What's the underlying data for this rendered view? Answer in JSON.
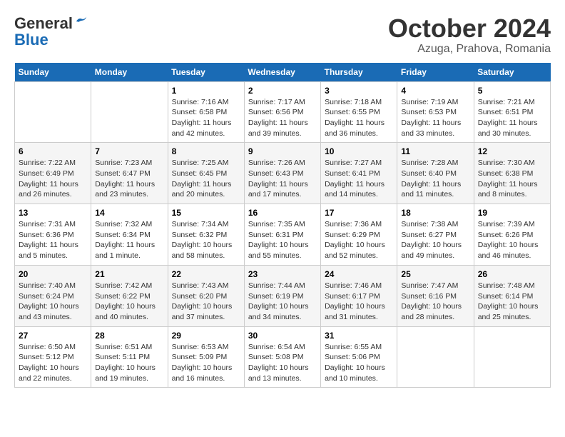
{
  "header": {
    "logo_line1": "General",
    "logo_line2": "Blue",
    "title": "October 2024",
    "subtitle": "Azuga, Prahova, Romania"
  },
  "days_of_week": [
    "Sunday",
    "Monday",
    "Tuesday",
    "Wednesday",
    "Thursday",
    "Friday",
    "Saturday"
  ],
  "weeks": [
    [
      {
        "day": "",
        "info": ""
      },
      {
        "day": "",
        "info": ""
      },
      {
        "day": "1",
        "info": "Sunrise: 7:16 AM\nSunset: 6:58 PM\nDaylight: 11 hours and 42 minutes."
      },
      {
        "day": "2",
        "info": "Sunrise: 7:17 AM\nSunset: 6:56 PM\nDaylight: 11 hours and 39 minutes."
      },
      {
        "day": "3",
        "info": "Sunrise: 7:18 AM\nSunset: 6:55 PM\nDaylight: 11 hours and 36 minutes."
      },
      {
        "day": "4",
        "info": "Sunrise: 7:19 AM\nSunset: 6:53 PM\nDaylight: 11 hours and 33 minutes."
      },
      {
        "day": "5",
        "info": "Sunrise: 7:21 AM\nSunset: 6:51 PM\nDaylight: 11 hours and 30 minutes."
      }
    ],
    [
      {
        "day": "6",
        "info": "Sunrise: 7:22 AM\nSunset: 6:49 PM\nDaylight: 11 hours and 26 minutes."
      },
      {
        "day": "7",
        "info": "Sunrise: 7:23 AM\nSunset: 6:47 PM\nDaylight: 11 hours and 23 minutes."
      },
      {
        "day": "8",
        "info": "Sunrise: 7:25 AM\nSunset: 6:45 PM\nDaylight: 11 hours and 20 minutes."
      },
      {
        "day": "9",
        "info": "Sunrise: 7:26 AM\nSunset: 6:43 PM\nDaylight: 11 hours and 17 minutes."
      },
      {
        "day": "10",
        "info": "Sunrise: 7:27 AM\nSunset: 6:41 PM\nDaylight: 11 hours and 14 minutes."
      },
      {
        "day": "11",
        "info": "Sunrise: 7:28 AM\nSunset: 6:40 PM\nDaylight: 11 hours and 11 minutes."
      },
      {
        "day": "12",
        "info": "Sunrise: 7:30 AM\nSunset: 6:38 PM\nDaylight: 11 hours and 8 minutes."
      }
    ],
    [
      {
        "day": "13",
        "info": "Sunrise: 7:31 AM\nSunset: 6:36 PM\nDaylight: 11 hours and 5 minutes."
      },
      {
        "day": "14",
        "info": "Sunrise: 7:32 AM\nSunset: 6:34 PM\nDaylight: 11 hours and 1 minute."
      },
      {
        "day": "15",
        "info": "Sunrise: 7:34 AM\nSunset: 6:32 PM\nDaylight: 10 hours and 58 minutes."
      },
      {
        "day": "16",
        "info": "Sunrise: 7:35 AM\nSunset: 6:31 PM\nDaylight: 10 hours and 55 minutes."
      },
      {
        "day": "17",
        "info": "Sunrise: 7:36 AM\nSunset: 6:29 PM\nDaylight: 10 hours and 52 minutes."
      },
      {
        "day": "18",
        "info": "Sunrise: 7:38 AM\nSunset: 6:27 PM\nDaylight: 10 hours and 49 minutes."
      },
      {
        "day": "19",
        "info": "Sunrise: 7:39 AM\nSunset: 6:26 PM\nDaylight: 10 hours and 46 minutes."
      }
    ],
    [
      {
        "day": "20",
        "info": "Sunrise: 7:40 AM\nSunset: 6:24 PM\nDaylight: 10 hours and 43 minutes."
      },
      {
        "day": "21",
        "info": "Sunrise: 7:42 AM\nSunset: 6:22 PM\nDaylight: 10 hours and 40 minutes."
      },
      {
        "day": "22",
        "info": "Sunrise: 7:43 AM\nSunset: 6:20 PM\nDaylight: 10 hours and 37 minutes."
      },
      {
        "day": "23",
        "info": "Sunrise: 7:44 AM\nSunset: 6:19 PM\nDaylight: 10 hours and 34 minutes."
      },
      {
        "day": "24",
        "info": "Sunrise: 7:46 AM\nSunset: 6:17 PM\nDaylight: 10 hours and 31 minutes."
      },
      {
        "day": "25",
        "info": "Sunrise: 7:47 AM\nSunset: 6:16 PM\nDaylight: 10 hours and 28 minutes."
      },
      {
        "day": "26",
        "info": "Sunrise: 7:48 AM\nSunset: 6:14 PM\nDaylight: 10 hours and 25 minutes."
      }
    ],
    [
      {
        "day": "27",
        "info": "Sunrise: 6:50 AM\nSunset: 5:12 PM\nDaylight: 10 hours and 22 minutes."
      },
      {
        "day": "28",
        "info": "Sunrise: 6:51 AM\nSunset: 5:11 PM\nDaylight: 10 hours and 19 minutes."
      },
      {
        "day": "29",
        "info": "Sunrise: 6:53 AM\nSunset: 5:09 PM\nDaylight: 10 hours and 16 minutes."
      },
      {
        "day": "30",
        "info": "Sunrise: 6:54 AM\nSunset: 5:08 PM\nDaylight: 10 hours and 13 minutes."
      },
      {
        "day": "31",
        "info": "Sunrise: 6:55 AM\nSunset: 5:06 PM\nDaylight: 10 hours and 10 minutes."
      },
      {
        "day": "",
        "info": ""
      },
      {
        "day": "",
        "info": ""
      }
    ]
  ]
}
